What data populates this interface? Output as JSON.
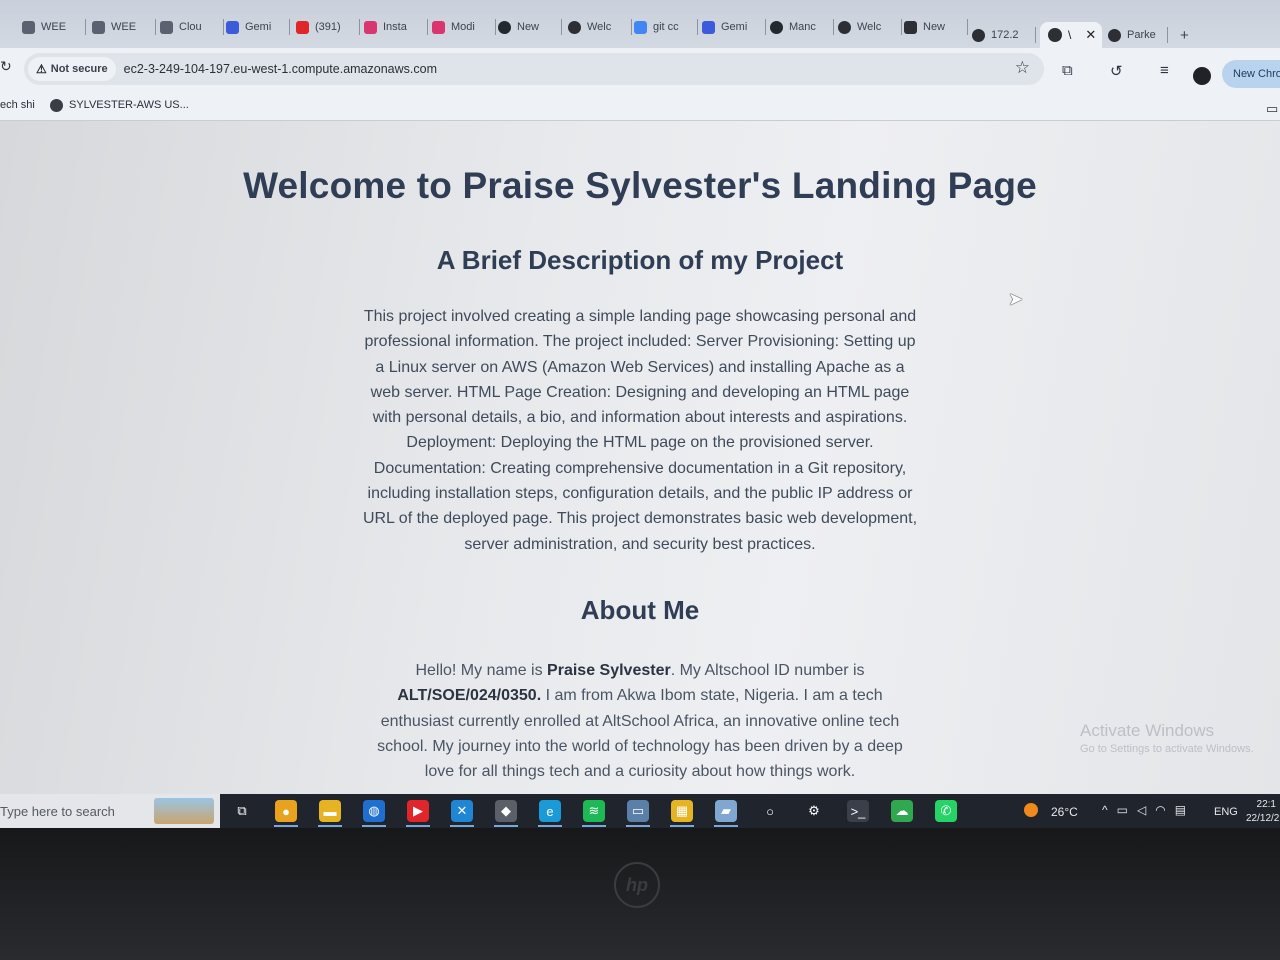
{
  "browser": {
    "tabs": [
      {
        "label": "WEE",
        "icon": "folder-icon",
        "color": "#5b6170"
      },
      {
        "label": "WEE",
        "icon": "folder-icon",
        "color": "#5b6170"
      },
      {
        "label": "Clou",
        "icon": "folder-icon",
        "color": "#5b6170"
      },
      {
        "label": "Gemi",
        "icon": "gemini-icon",
        "color": "#3b5bdb"
      },
      {
        "label": "(391)",
        "icon": "youtube-icon",
        "color": "#e0262b"
      },
      {
        "label": "Insta",
        "icon": "instagram-icon",
        "color": "#d9366f"
      },
      {
        "label": "Modi",
        "icon": "app-icon",
        "color": "#d9366f"
      },
      {
        "label": "New",
        "icon": "github-icon",
        "color": "#24292f"
      },
      {
        "label": "Welc",
        "icon": "globe-icon",
        "color": "#2d2f35"
      },
      {
        "label": "git cc",
        "icon": "google-icon",
        "color": "#4285f4"
      },
      {
        "label": "Gemi",
        "icon": "gemini-icon",
        "color": "#3b5bdb"
      },
      {
        "label": "Manc",
        "icon": "github-icon",
        "color": "#24292f"
      },
      {
        "label": "Welc",
        "icon": "globe-icon",
        "color": "#2d2f35"
      },
      {
        "label": "New",
        "icon": "app-icon",
        "color": "#2d2f35"
      },
      {
        "label": "172.2",
        "icon": "globe-icon",
        "color": "#2d2f35"
      },
      {
        "label": "Parke",
        "icon": "globe-icon",
        "color": "#2d2f35"
      }
    ],
    "active_tab": {
      "label": "\\",
      "icon": "globe-icon"
    },
    "security_label": "Not secure",
    "url": "ec2-3-249-104-197.eu-west-1.compute.amazonaws.com",
    "new_chrome_label": "New Chro",
    "bookmarks": {
      "item1": "ech shi",
      "item2": "SYLVESTER-AWS US..."
    }
  },
  "page": {
    "title": "Welcome to Praise Sylvester's Landing Page",
    "project_heading": "A Brief Description of my Project",
    "project_text": "This project involved creating a simple landing page showcasing personal and professional information. The project included: Server Provisioning: Setting up a Linux server on AWS (Amazon Web Services) and installing Apache as a web server. HTML Page Creation: Designing and developing an HTML page with personal details, a bio, and information about interests and aspirations. Deployment: Deploying the HTML page on the provisioned server. Documentation: Creating comprehensive documentation in a Git repository, including installation steps, configuration details, and the public IP address or URL of the deployed page. This project demonstrates basic web development, server administration, and security best practices.",
    "about_heading": "About Me",
    "about": {
      "intro": "Hello! My name is ",
      "name": "Praise Sylvester",
      "id_prefix": ". My Altschool ID number is ",
      "id": "ALT/SOE/024/0350.",
      "rest": " I am from Akwa Ibom state, Nigeria. I am a tech enthusiast currently enrolled at AltSchool Africa, an innovative online tech school. My journey into the world of technology has been driven by a deep love for all things tech and a curiosity about how things work."
    }
  },
  "overlay": {
    "activate_title": "Activate Windows",
    "activate_sub": "Go to Settings to activate Windows."
  },
  "taskbar": {
    "search_placeholder": "Type here to search",
    "apps": [
      {
        "name": "task-view-icon",
        "color": "#20252d",
        "glyph": "⧉"
      },
      {
        "name": "chrome-icon",
        "color": "#e8a21e",
        "glyph": "●"
      },
      {
        "name": "file-explorer-icon",
        "color": "#e6b422",
        "glyph": "▬"
      },
      {
        "name": "app-circle-icon",
        "color": "#1f6fd1",
        "glyph": "◍"
      },
      {
        "name": "youtube-icon",
        "color": "#e0262b",
        "glyph": "▶"
      },
      {
        "name": "vscode-icon",
        "color": "#1f86d6",
        "glyph": "✕"
      },
      {
        "name": "git-icon",
        "color": "#5a5f68",
        "glyph": "◆"
      },
      {
        "name": "edge-icon",
        "color": "#1a9ad6",
        "glyph": "e"
      },
      {
        "name": "spotify-icon",
        "color": "#1db954",
        "glyph": "≋"
      },
      {
        "name": "monitor-icon",
        "color": "#5a7fa8",
        "glyph": "▭"
      },
      {
        "name": "calculator-icon",
        "color": "#e6b422",
        "glyph": "▦"
      },
      {
        "name": "notes-icon",
        "color": "#7fa7d1",
        "glyph": "▰"
      },
      {
        "name": "app-ring-icon",
        "color": "#20252d",
        "glyph": "○"
      },
      {
        "name": "settings-icon",
        "color": "#20252d",
        "glyph": "⚙"
      },
      {
        "name": "terminal-icon",
        "color": "#3a3f49",
        "glyph": ">_"
      },
      {
        "name": "cloud-icon",
        "color": "#2fa84f",
        "glyph": "☁"
      },
      {
        "name": "whatsapp-icon",
        "color": "#25d366",
        "glyph": "✆"
      }
    ],
    "temperature": "26°C",
    "language": "ENG",
    "time": "22:1",
    "date": "22/12/2"
  }
}
